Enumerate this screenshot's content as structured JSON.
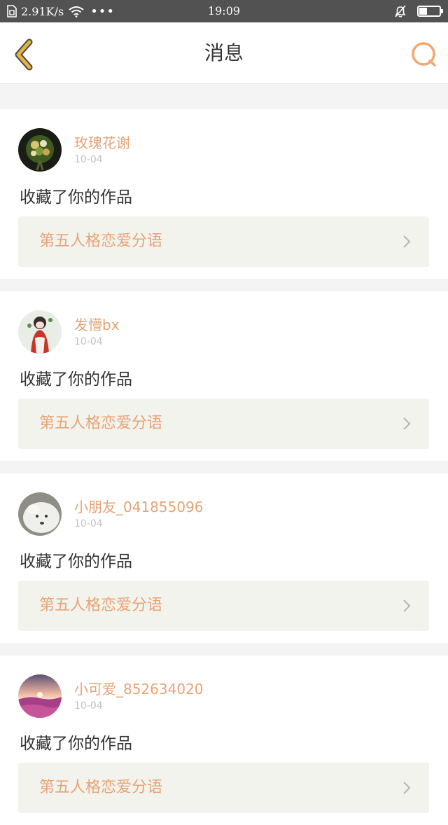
{
  "status_bar": {
    "speed": "2.91K/s",
    "dots": "•••",
    "time": "19:09",
    "battery_level": 0.4
  },
  "header": {
    "title": "消息",
    "back_icon": "chevron-left-icon",
    "search_icon": "search-icon"
  },
  "colors": {
    "accent": "#e8a376",
    "back": "#e4b43e",
    "search": "#f2a774",
    "card_link_bg": "#f3f3ed"
  },
  "notifications": [
    {
      "username": "玫瑰花谢",
      "date": "10-04",
      "action": "收藏了你的作品",
      "work_title": "第五人格恋爱分语",
      "avatar": "bouquet"
    },
    {
      "username": "发懵bx",
      "date": "10-04",
      "action": "收藏了你的作品",
      "work_title": "第五人格恋爱分语",
      "avatar": "anime"
    },
    {
      "username": "小朋友_041855096",
      "date": "10-04",
      "action": "收藏了你的作品",
      "work_title": "第五人格恋爱分语",
      "avatar": "dog"
    },
    {
      "username": "小可爱_852634020",
      "date": "10-04",
      "action": "收藏了你的作品",
      "work_title": "第五人格恋爱分语",
      "avatar": "sunset"
    }
  ]
}
